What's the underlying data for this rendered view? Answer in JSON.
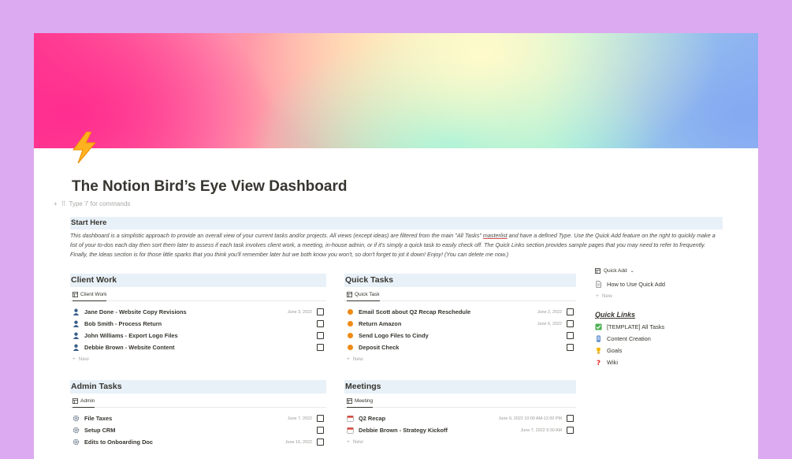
{
  "page": {
    "title": "The Notion Bird’s Eye View Dashboard",
    "icon": "lightning-bolt-icon",
    "command_hint": "Type '/' for commands"
  },
  "intro": {
    "heading": "Start Here",
    "text_before": "This dashboard is a simplistic approach to provide an overall view of your current tasks and/or projects. All views (except ideas) are filtered from the main \"All Tasks\" ",
    "link": "masterlist",
    "text_after": " and have a defined Type. Use the Quick Add feature on the right to quickly make a list of your to-dos each day then sort them later to assess if each task involves client work, a meeting, in-house admin, or if it's simply a quick task to easily check off. The Quick Links section provides sample pages that you may need to refer to frequently. Finally, the Ideas section is for those little sparks that you think you'll remember later but we both know you won't, so don't forget to jot it down! Enjoy! (You can delete me now.)"
  },
  "client_work": {
    "heading": "Client Work",
    "tab": "Client Work",
    "new_label": "New",
    "rows": [
      {
        "name": "Jane Done - Website Copy Revisions",
        "date": "June 3, 2022",
        "icon": "person-icon"
      },
      {
        "name": "Bob Smith - Process Return",
        "date": "",
        "icon": "person-icon"
      },
      {
        "name": "John Williams - Export Logo Files",
        "date": "",
        "icon": "person-icon"
      },
      {
        "name": "Debbie Brown - Website Content",
        "date": "",
        "icon": "person-icon"
      }
    ]
  },
  "quick_tasks": {
    "heading": "Quick Tasks",
    "tab": "Quick Task",
    "new_label": "New",
    "rows": [
      {
        "name": "Email Scott about Q2 Recap Reschedule",
        "date": "June 2, 2022",
        "icon": "orange-dot-icon"
      },
      {
        "name": "Return Amazon",
        "date": "June 6, 2022",
        "icon": "orange-dot-icon"
      },
      {
        "name": "Send Logo Files to Cindy",
        "date": "",
        "icon": "orange-dot-icon"
      },
      {
        "name": "Deposit Check",
        "date": "",
        "icon": "orange-dot-icon"
      }
    ]
  },
  "admin_tasks": {
    "heading": "Admin Tasks",
    "tab": "Admin",
    "rows": [
      {
        "name": "File Taxes",
        "date": "June 7, 2022",
        "icon": "gear-icon"
      },
      {
        "name": "Setup CRM",
        "date": "",
        "icon": "gear-icon"
      },
      {
        "name": "Edits to Onboarding Doc",
        "date": "June 16, 2022",
        "icon": "gear-icon"
      }
    ]
  },
  "meetings": {
    "heading": "Meetings",
    "tab": "Meeting",
    "new_label": "New",
    "rows": [
      {
        "name": "Q2 Recap",
        "date": "June 9, 2022 10:00 AM-12:00 PM",
        "icon": "calendar-icon"
      },
      {
        "name": "Debbie Brown - Strategy Kickoff",
        "date": "June 7, 2022 9:30 AM",
        "icon": "calendar-icon"
      }
    ]
  },
  "quick_add": {
    "button": "Quick Add",
    "item": "How to Use Quick Add",
    "new_label": "New"
  },
  "quick_links": {
    "heading": "Quick Links",
    "items": [
      {
        "label": "[TEMPLATE] All Tasks",
        "icon": "checkbox-icon"
      },
      {
        "label": "Content Creation",
        "icon": "phone-icon"
      },
      {
        "label": "Goals",
        "icon": "trophy-icon"
      },
      {
        "label": "Wiki",
        "icon": "question-icon"
      }
    ]
  },
  "colors": {
    "background": "#dcaaf0",
    "section_header": "#e8f1f8",
    "accent_orange": "#ef8a14",
    "text": "#37352f"
  }
}
